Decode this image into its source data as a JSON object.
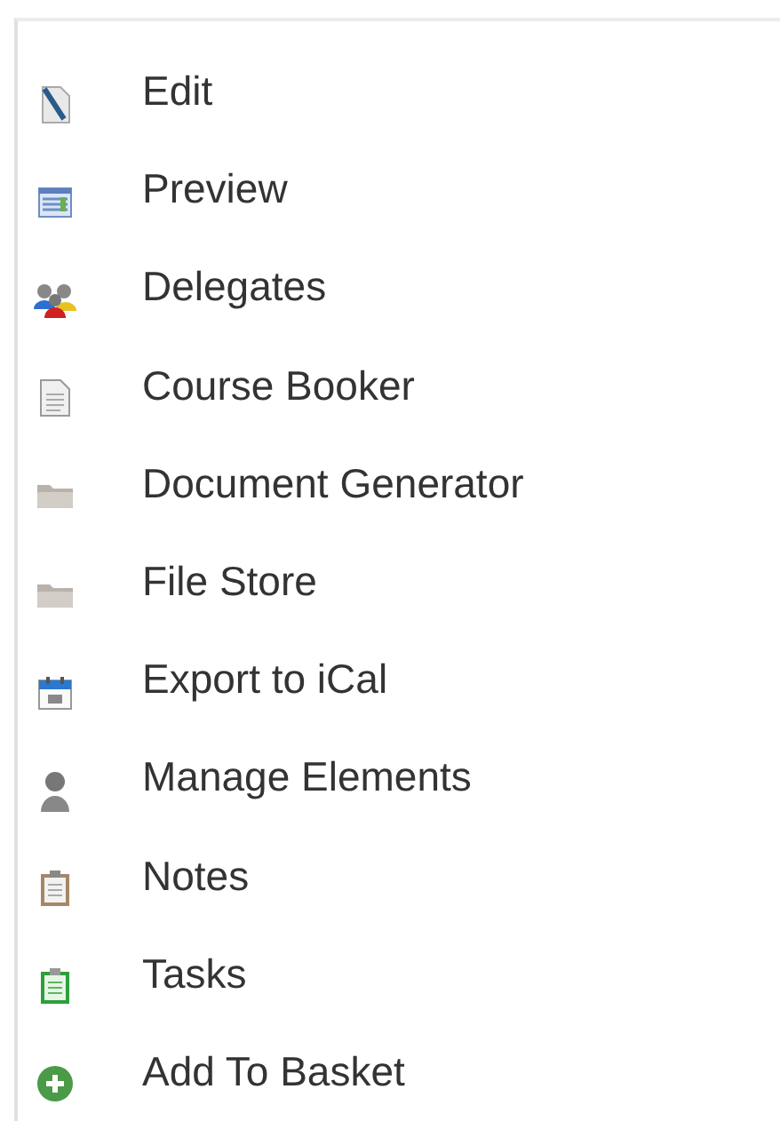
{
  "menu": {
    "items": [
      {
        "label": "Edit"
      },
      {
        "label": "Preview"
      },
      {
        "label": "Delegates"
      },
      {
        "label": "Course Booker"
      },
      {
        "label": "Document Generator"
      },
      {
        "label": "File Store"
      },
      {
        "label": "Export to iCal"
      },
      {
        "label": "Manage Elements"
      },
      {
        "label": "Notes"
      },
      {
        "label": "Tasks"
      },
      {
        "label": "Add To Basket"
      }
    ]
  }
}
